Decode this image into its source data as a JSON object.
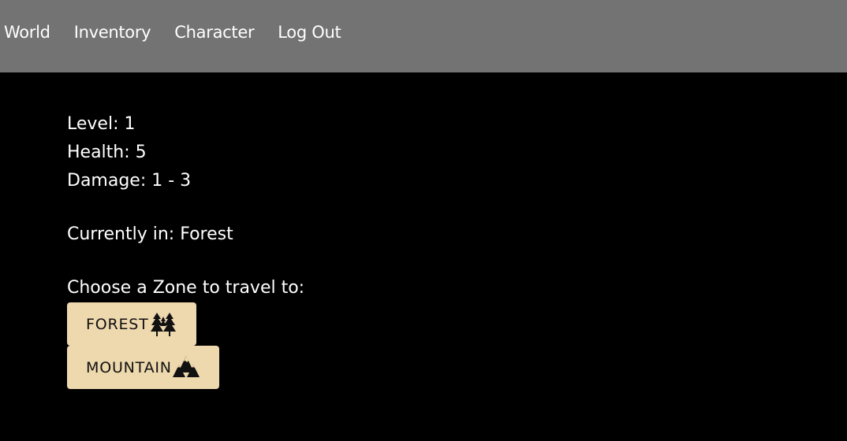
{
  "nav": {
    "items": [
      {
        "label": "World"
      },
      {
        "label": "Inventory"
      },
      {
        "label": "Character"
      },
      {
        "label": "Log Out"
      }
    ]
  },
  "stats": {
    "level": "Level: 1",
    "health": "Health: 5",
    "damage": "Damage: 1 - 3"
  },
  "location": {
    "current": "Currently in: Forest"
  },
  "zones": {
    "prompt": "Choose a Zone to travel to:",
    "buttons": [
      {
        "label": "FOREST",
        "icon": "forest-icon"
      },
      {
        "label": "MOUNTAIN",
        "icon": "mountain-icon"
      }
    ]
  },
  "colors": {
    "navbar_bg": "#737373",
    "page_bg": "#000000",
    "button_bg": "#eed8ae",
    "text": "#ffffff"
  }
}
